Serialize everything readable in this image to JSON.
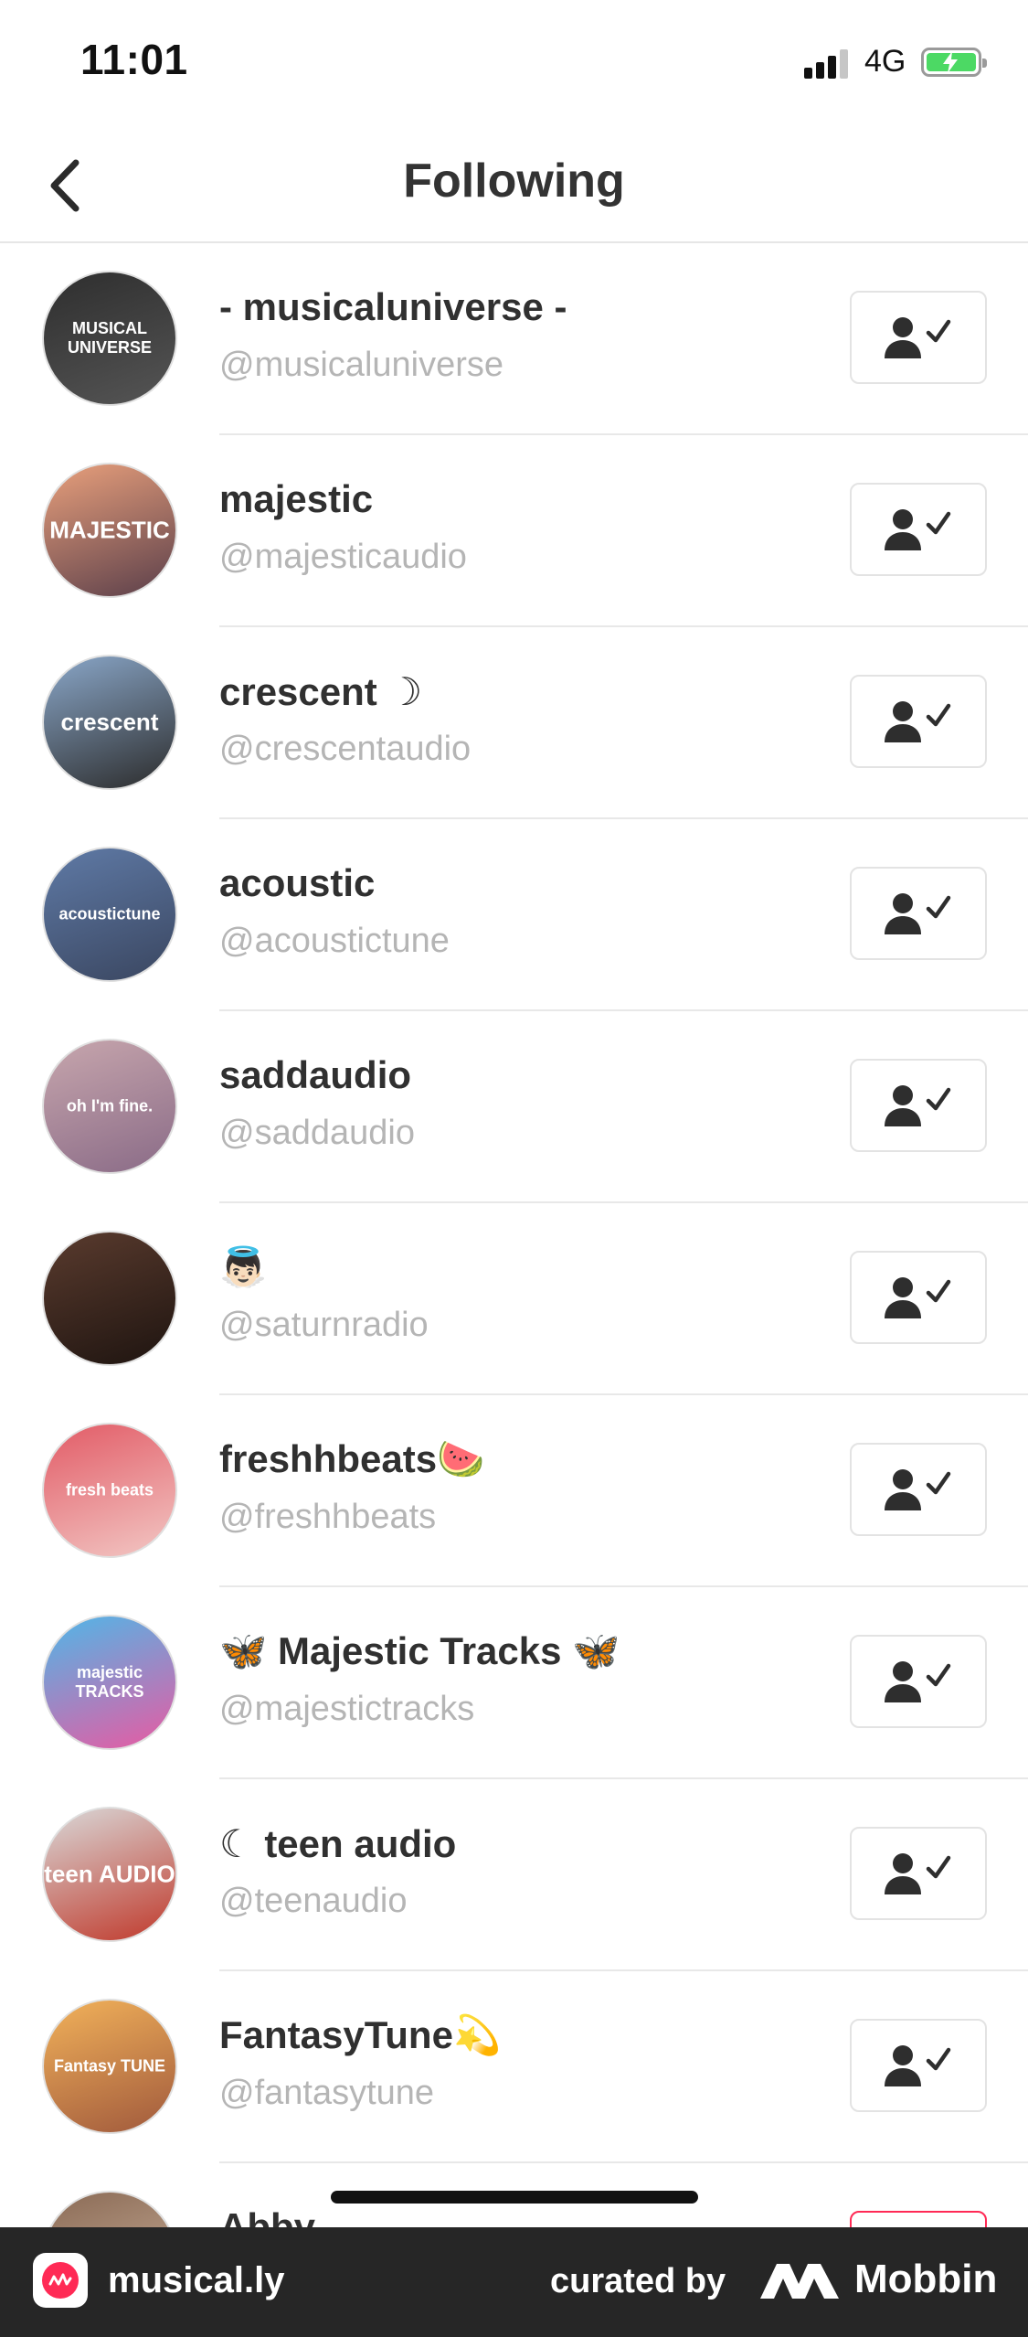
{
  "status_bar": {
    "time": "11:01",
    "network": "4G",
    "signal_bars": 3,
    "battery_level": 0.8
  },
  "nav": {
    "title": "Following"
  },
  "following": [
    {
      "name": "- musicaluniverse -",
      "handle": "@musicaluniverse",
      "avatar_text": "MUSICAL UNIVERSE",
      "avatar_colors": [
        "#2e2e2e",
        "#555555"
      ]
    },
    {
      "name": "majestic",
      "handle": "@majesticaudio",
      "avatar_text": "MAJESTIC",
      "avatar_colors": [
        "#e9a07c",
        "#5b3f4a"
      ]
    },
    {
      "name": "crescent ☽",
      "handle": "@crescentaudio",
      "avatar_text": "crescent",
      "avatar_colors": [
        "#8aa7c9",
        "#2c2c2c"
      ]
    },
    {
      "name": "acoustic",
      "handle": "@acoustictune",
      "avatar_text": "acoustictune",
      "avatar_colors": [
        "#5f7aa6",
        "#3a4660"
      ]
    },
    {
      "name": "saddaudio",
      "handle": "@saddaudio",
      "avatar_text": "oh I'm fine.",
      "avatar_colors": [
        "#c7a6ad",
        "#8a6b87"
      ]
    },
    {
      "name": "👼🏻",
      "handle": "@saturnradio",
      "avatar_text": "",
      "avatar_colors": [
        "#5a3b2e",
        "#1e1410"
      ]
    },
    {
      "name": "freshhbeats🍉",
      "handle": "@freshhbeats",
      "avatar_text": "fresh beats",
      "avatar_colors": [
        "#e25b66",
        "#f2c7c4"
      ]
    },
    {
      "name": "🦋 Majestic Tracks 🦋",
      "handle": "@majestictracks",
      "avatar_text": "majestic TRACKS",
      "avatar_colors": [
        "#4fb7e8",
        "#e85aa2"
      ]
    },
    {
      "name": "☾ teen audio",
      "handle": "@teenaudio",
      "avatar_text": "teen AUDIO",
      "avatar_colors": [
        "#d9d9d9",
        "#c0392b"
      ]
    },
    {
      "name": "FantasyTune💫",
      "handle": "@fantasytune",
      "avatar_text": "Fantasy TUNE",
      "avatar_colors": [
        "#f2b25a",
        "#a0593c"
      ]
    },
    {
      "name": "Abby",
      "handle": "",
      "avatar_text": "",
      "avatar_colors": [
        "#8a6a55",
        "#d3b9a3"
      ]
    }
  ],
  "footer": {
    "app_name": "musical.ly",
    "curated_by": "curated by",
    "brand": "Mobbin"
  },
  "colors": {
    "accent_pink": "#ff2a55",
    "handle_gray": "#b5b5b5",
    "footer_bg": "#262626"
  }
}
